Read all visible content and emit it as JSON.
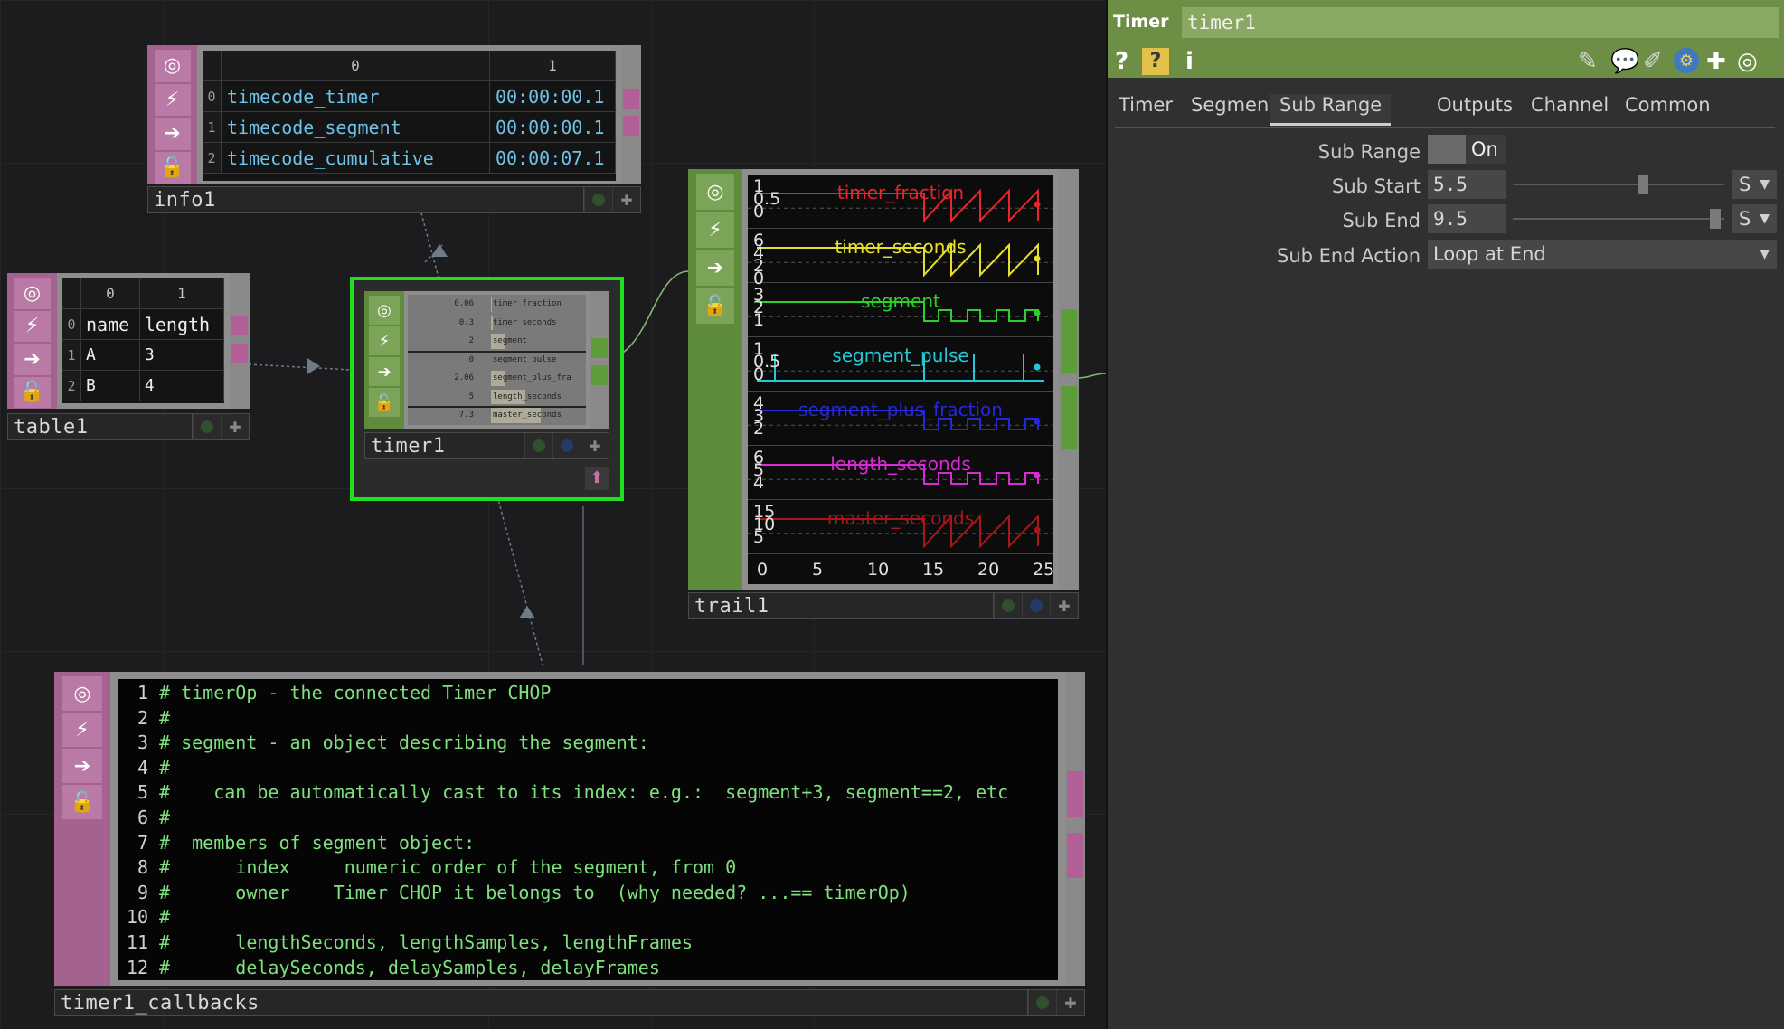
{
  "network": {
    "info1": {
      "name": "info1",
      "columns": [
        "0",
        "1"
      ],
      "rows": [
        {
          "index": "0",
          "name": "timecode_timer",
          "value": "00:00:00.1"
        },
        {
          "index": "1",
          "name": "timecode_segment",
          "value": "00:00:00.1"
        },
        {
          "index": "2",
          "name": "timecode_cumulative",
          "value": "00:00:07.1"
        }
      ]
    },
    "table1": {
      "name": "table1",
      "columns": [
        "0",
        "1"
      ],
      "rows": [
        {
          "index": "0",
          "c0": "name",
          "c1": "length"
        },
        {
          "index": "1",
          "c0": "A",
          "c1": "3"
        },
        {
          "index": "2",
          "c0": "B",
          "c1": "4"
        }
      ]
    },
    "timer1": {
      "name": "timer1",
      "channels": [
        {
          "value": "0.06",
          "name": "timer_fraction"
        },
        {
          "value": "0.3",
          "name": "timer_seconds"
        },
        {
          "value": "2",
          "name": "segment"
        },
        {
          "value": "0",
          "name": "segment_pulse"
        },
        {
          "value": "2.06",
          "name": "segment_plus_fra"
        },
        {
          "value": "5",
          "name": "length_seconds"
        },
        {
          "value": "7.3",
          "name": "master_seconds"
        }
      ]
    },
    "trail1": {
      "name": "trail1",
      "channels": [
        {
          "name": "timer_fraction",
          "color": "#e8252a",
          "ticks": [
            "1",
            "0.5",
            "0"
          ]
        },
        {
          "name": "timer_seconds",
          "color": "#e6e02a",
          "ticks": [
            "6",
            "4",
            "2",
            "0"
          ]
        },
        {
          "name": "segment",
          "color": "#2ad12a",
          "ticks": [
            "3",
            "2",
            "1"
          ]
        },
        {
          "name": "segment_pulse",
          "color": "#22c9d4",
          "ticks": [
            "1",
            "0.5",
            "0"
          ]
        },
        {
          "name": "segment_plus_fraction",
          "color": "#2528d8",
          "ticks": [
            "4",
            "3",
            "2"
          ]
        },
        {
          "name": "length_seconds",
          "color": "#d62ad2",
          "ticks": [
            "6",
            "5",
            "4"
          ]
        },
        {
          "name": "master_seconds",
          "color": "#a8161a",
          "ticks": [
            "15",
            "10",
            "5"
          ]
        }
      ],
      "x_ticks": [
        "0",
        "5",
        "10",
        "15",
        "20",
        "25"
      ]
    },
    "callbacks": {
      "name": "timer1_callbacks",
      "lines": [
        {
          "n": "1",
          "text": "# timerOp - the connected Timer CHOP"
        },
        {
          "n": "2",
          "text": "#"
        },
        {
          "n": "3",
          "text": "# segment - an object describing the segment:"
        },
        {
          "n": "4",
          "text": "#"
        },
        {
          "n": "5",
          "text": "#    can be automatically cast to its index: e.g.:  segment+3, segment==2, etc"
        },
        {
          "n": "6",
          "text": "#"
        },
        {
          "n": "7",
          "text": "#  members of segment object:"
        },
        {
          "n": "8",
          "text": "#      index     numeric order of the segment, from 0"
        },
        {
          "n": "9",
          "text": "#      owner    Timer CHOP it belongs to  (why needed? ...== timerOp)"
        },
        {
          "n": "10",
          "text": "#"
        },
        {
          "n": "11",
          "text": "#      lengthSeconds, lengthSamples, lengthFrames"
        },
        {
          "n": "12",
          "text": "#      delaySeconds, delaySamples, delayFrames"
        }
      ]
    }
  },
  "panel": {
    "op_type": "Timer",
    "op_name": "timer1",
    "tabs": [
      "Timer",
      "Segments",
      "Sub Range",
      "Outputs",
      "Channel",
      "Common"
    ],
    "active_tab": "Sub Range",
    "params": {
      "sub_range": {
        "label": "Sub Range",
        "value": "On"
      },
      "sub_start": {
        "label": "Sub Start",
        "value": "5.5",
        "unit": "S",
        "slider_level": 0.62
      },
      "sub_end": {
        "label": "Sub End",
        "value": "9.5",
        "unit": "S",
        "slider_level": 0.98
      },
      "sub_end_action": {
        "label": "Sub End Action",
        "value": "Loop at End"
      }
    },
    "icon_colors": {
      "header": "#6c8f45",
      "python": "#3e79c2"
    }
  }
}
